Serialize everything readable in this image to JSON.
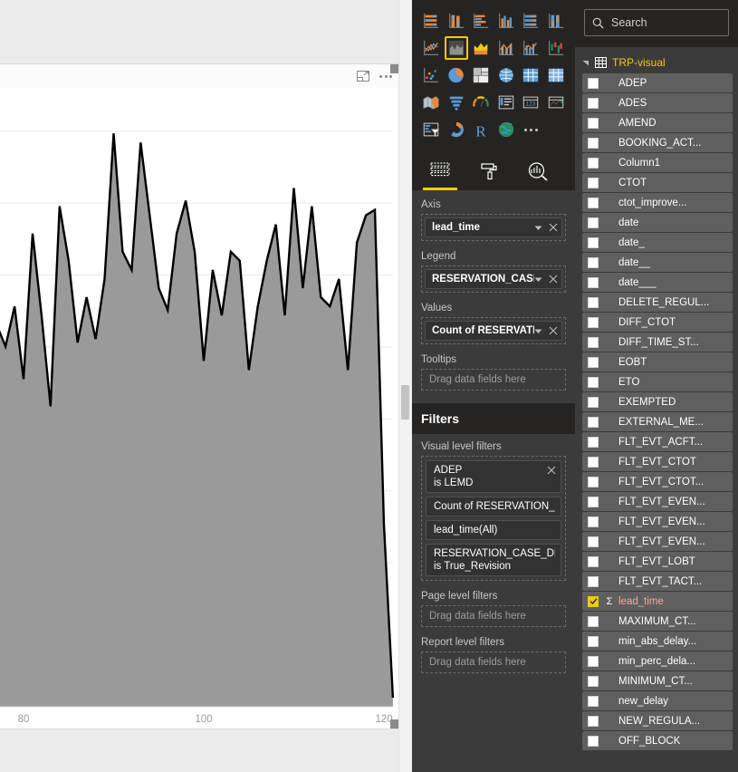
{
  "canvas": {
    "visual_header": {
      "focus_icon": "focus-mode-icon",
      "more_icon": "more-options-icon"
    }
  },
  "chart_data": {
    "type": "area",
    "title": "",
    "xlabel": "lead_time",
    "ylabel": "Count of RESERVATION",
    "xlim": [
      76,
      122
    ],
    "ylim": [
      0,
      34
    ],
    "xticks": [
      80,
      100,
      120
    ],
    "xtick_labels": [
      "80",
      "100",
      "120"
    ],
    "grid": true,
    "legend_position": "none",
    "series": [
      {
        "name": "True_Revision",
        "fill_color": "#9a9a9a",
        "line_color": "#000000",
        "x": [
          76,
          77,
          78,
          79,
          80,
          81,
          82,
          83,
          84,
          85,
          86,
          87,
          88,
          89,
          90,
          91,
          92,
          93,
          94,
          95,
          96,
          97,
          98,
          99,
          100,
          101,
          102,
          103,
          104,
          105,
          106,
          107,
          108,
          109,
          110,
          111,
          112,
          113,
          114,
          115,
          116,
          117,
          118,
          119,
          120,
          121
        ],
        "values": [
          22.5,
          21.0,
          19.8,
          22.0,
          18.0,
          26.0,
          21.5,
          16.5,
          27.5,
          24.5,
          20.0,
          22.5,
          20.2,
          23.5,
          31.5,
          25.0,
          24.0,
          31.0,
          27.0,
          23.0,
          21.8,
          26.0,
          27.8,
          25.0,
          19.0,
          24.0,
          21.5,
          25.0,
          24.5,
          18.5,
          22.0,
          24.5,
          26.5,
          21.5,
          28.5,
          23.0,
          27.5,
          22.5,
          22.0,
          23.5,
          18.5,
          25.5,
          27.0,
          27.3,
          10.0,
          0.5
        ]
      }
    ]
  },
  "visualizations_pane": {
    "gallery": [
      [
        "stacked-bar-chart-icon",
        "stacked-column-chart-icon",
        "clustered-bar-chart-icon",
        "clustered-column-chart-icon",
        "100-stacked-bar-chart-icon",
        "100-stacked-column-chart-icon"
      ],
      [
        "line-chart-icon",
        "area-chart-icon",
        "stacked-area-chart-icon",
        "line-and-stacked-column-chart-icon",
        "line-and-clustered-column-chart-icon",
        "ribbon-chart-icon"
      ],
      [
        "scatter-chart-icon",
        "pie-chart-icon",
        "treemap-icon",
        "map-icon",
        "table-icon",
        "matrix-icon"
      ],
      [
        "filled-map-icon",
        "funnel-icon",
        "gauge-icon",
        "multi-row-card-icon",
        "card-icon",
        "kpi-icon"
      ],
      [
        "slicer-icon",
        "donut-chart-icon",
        "r-script-visual-icon",
        "arcgis-map-icon",
        "more-visuals-icon"
      ]
    ],
    "selected_visual": "area-chart-icon",
    "tabs": [
      {
        "label": "Fields",
        "icon": "fields-pane-icon",
        "active": true
      },
      {
        "label": "Format",
        "icon": "paint-roller-icon",
        "active": false
      },
      {
        "label": "Analytics",
        "icon": "analytics-magnifier-icon",
        "active": false
      }
    ],
    "wells": [
      {
        "label": "Axis",
        "field": "lead_time",
        "has_field": true
      },
      {
        "label": "Legend",
        "field": "RESERVATION_CASE_DE",
        "has_field": true
      },
      {
        "label": "Values",
        "field": "Count of RESERVATION",
        "has_field": true
      },
      {
        "label": "Tooltips",
        "field": "Drag data fields here",
        "has_field": false
      }
    ]
  },
  "filters": {
    "title": "Filters",
    "sections": [
      {
        "label": "Visual level filters",
        "cards": [
          {
            "line1": "ADEP",
            "line2": "is LEMD",
            "closable": true
          },
          {
            "line1": "Count of RESERVATION_...",
            "line2": "",
            "closable": false
          },
          {
            "line1": "lead_time(All)",
            "line2": "",
            "closable": false
          },
          {
            "line1": "RESERVATION_CASE_DESC",
            "line2": "is True_Revision",
            "closable": false
          }
        ]
      },
      {
        "label": "Page level filters",
        "placeholder": "Drag data fields here"
      },
      {
        "label": "Report level filters",
        "placeholder": "Drag data fields here"
      }
    ]
  },
  "fields_pane": {
    "search_placeholder": "Search",
    "search_value": "",
    "table_name": "TRP-visual",
    "accent_color": "#f2c811",
    "fields": [
      {
        "name": "ADEP",
        "checked": false,
        "measure": false
      },
      {
        "name": "ADES",
        "checked": false,
        "measure": false
      },
      {
        "name": "AMEND",
        "checked": false,
        "measure": false
      },
      {
        "name": "BOOKING_ACT...",
        "checked": false,
        "measure": false
      },
      {
        "name": "Column1",
        "checked": false,
        "measure": false
      },
      {
        "name": "CTOT",
        "checked": false,
        "measure": false
      },
      {
        "name": "ctot_improve...",
        "checked": false,
        "measure": false
      },
      {
        "name": "date",
        "checked": false,
        "measure": false
      },
      {
        "name": "date_",
        "checked": false,
        "measure": false
      },
      {
        "name": "date__",
        "checked": false,
        "measure": false
      },
      {
        "name": "date___",
        "checked": false,
        "measure": false
      },
      {
        "name": "DELETE_REGUL...",
        "checked": false,
        "measure": false
      },
      {
        "name": "DIFF_CTOT",
        "checked": false,
        "measure": false
      },
      {
        "name": "DIFF_TIME_ST...",
        "checked": false,
        "measure": false
      },
      {
        "name": "EOBT",
        "checked": false,
        "measure": false
      },
      {
        "name": "ETO",
        "checked": false,
        "measure": false
      },
      {
        "name": "EXEMPTED",
        "checked": false,
        "measure": false
      },
      {
        "name": "EXTERNAL_ME...",
        "checked": false,
        "measure": false
      },
      {
        "name": "FLT_EVT_ACFT...",
        "checked": false,
        "measure": false
      },
      {
        "name": "FLT_EVT_CTOT",
        "checked": false,
        "measure": false
      },
      {
        "name": "FLT_EVT_CTOT...",
        "checked": false,
        "measure": false
      },
      {
        "name": "FLT_EVT_EVEN...",
        "checked": false,
        "measure": false
      },
      {
        "name": "FLT_EVT_EVEN...",
        "checked": false,
        "measure": false
      },
      {
        "name": "FLT_EVT_EVEN...",
        "checked": false,
        "measure": false
      },
      {
        "name": "FLT_EVT_LOBT",
        "checked": false,
        "measure": false
      },
      {
        "name": "FLT_EVT_TACT...",
        "checked": false,
        "measure": false
      },
      {
        "name": "lead_time",
        "checked": true,
        "measure": true
      },
      {
        "name": "MAXIMUM_CT...",
        "checked": false,
        "measure": false
      },
      {
        "name": "min_abs_delay...",
        "checked": false,
        "measure": false
      },
      {
        "name": "min_perc_dela...",
        "checked": false,
        "measure": false
      },
      {
        "name": "MINIMUM_CT...",
        "checked": false,
        "measure": false
      },
      {
        "name": "new_delay",
        "checked": false,
        "measure": false
      },
      {
        "name": "NEW_REGULA...",
        "checked": false,
        "measure": false
      },
      {
        "name": "OFF_BLOCK",
        "checked": false,
        "measure": false
      }
    ]
  }
}
